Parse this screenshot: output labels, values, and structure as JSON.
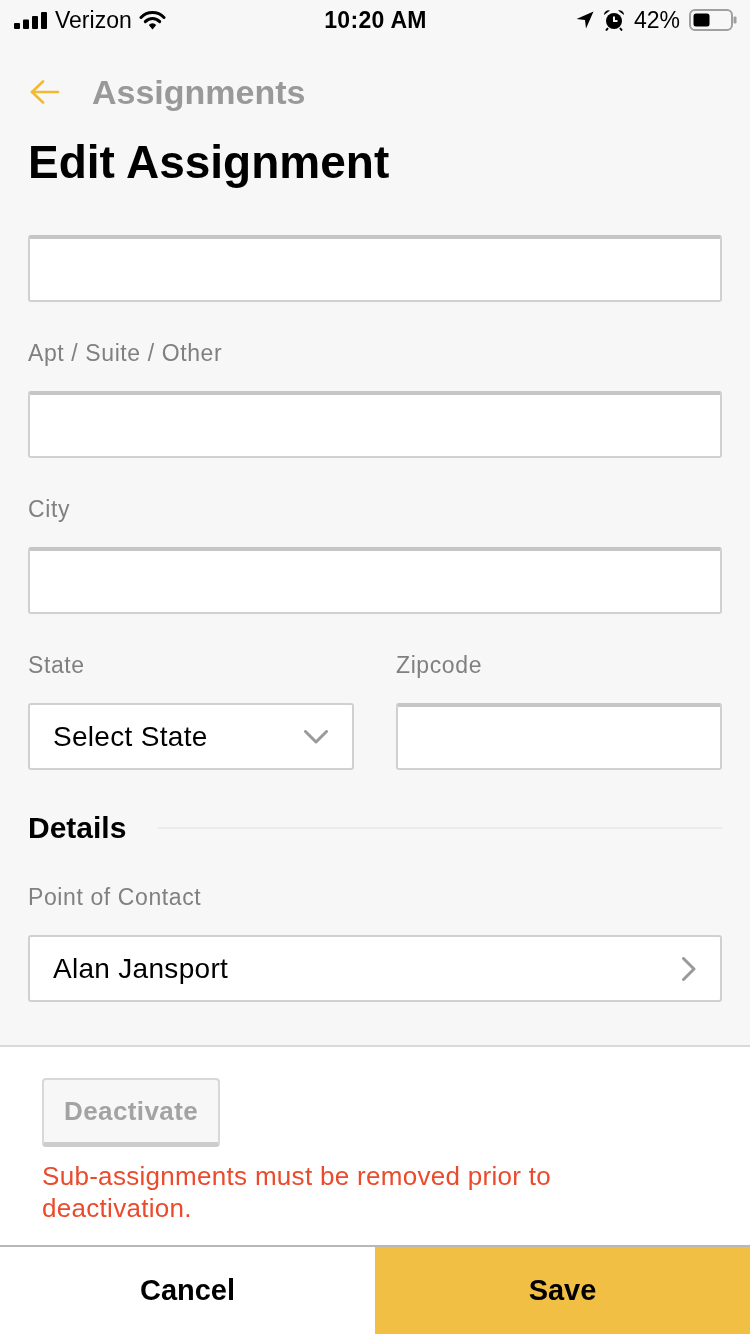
{
  "status_bar": {
    "carrier": "Verizon",
    "time": "10:20 AM",
    "battery": "42%"
  },
  "header": {
    "back_label": "Assignments",
    "title": "Edit Assignment"
  },
  "address_rows": [
    {
      "fields": [
        {
          "kind": "text"
        }
      ]
    },
    {
      "fields": [
        {
          "kind": "text",
          "label": "Apt / Suite / Other"
        }
      ]
    },
    {
      "fields": [
        {
          "kind": "text",
          "label": "City"
        }
      ]
    },
    {
      "fields": [
        {
          "kind": "select",
          "label": "State",
          "value": "Select State"
        },
        {
          "kind": "text",
          "label": "Zipcode"
        }
      ]
    }
  ],
  "details": {
    "heading": "Details",
    "fields": [
      {
        "kind": "link",
        "label": "Point of Contact",
        "value": "Alan Jansport"
      }
    ]
  },
  "deactivate": {
    "label": "Deactivate",
    "disabled": true,
    "message": "Sub-assignments must be removed prior to deactivation."
  },
  "actions": [
    {
      "kind": "secondary",
      "label": "Cancel"
    },
    {
      "kind": "primary",
      "label": "Save"
    }
  ]
}
